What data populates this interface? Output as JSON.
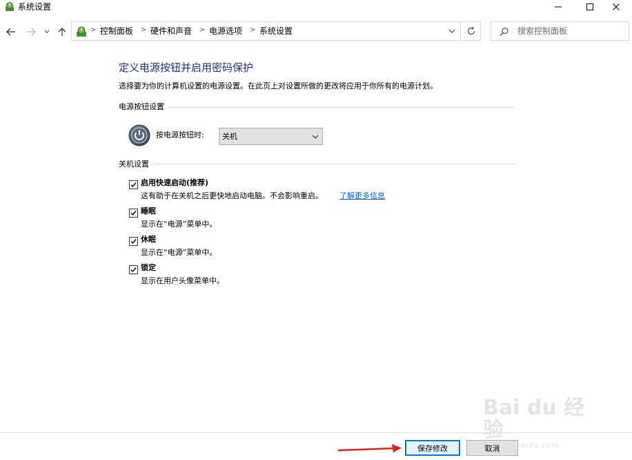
{
  "window": {
    "title": "系统设置",
    "icon": "power-options-icon"
  },
  "nav": {
    "back": "back-arrow-icon",
    "forward": "forward-arrow-icon",
    "recent": "chevron-down-icon",
    "up": "up-arrow-icon"
  },
  "breadcrumb": [
    "控制面板",
    "硬件和声音",
    "电源选项",
    "系统设置"
  ],
  "search": {
    "placeholder": "搜索控制面板"
  },
  "page": {
    "title": "定义电源按钮并启用密码保护",
    "description": "选择要为你的计算机设置的电源设置。在此页上对设置所做的更改将应用于你所有的电源计划。"
  },
  "power_button_section": {
    "heading": "电源按钮设置",
    "label": "按电源按钮时:",
    "selected": "关机"
  },
  "shutdown_section": {
    "heading": "关机设置",
    "items": [
      {
        "label": "启用快速启动(推荐)",
        "desc": "这有助于在关机之后更快地启动电脑。不会影响重启。",
        "link": "了解更多信息",
        "checked": true
      },
      {
        "label": "睡眠",
        "desc": "显示在“电源”菜单中。",
        "checked": true
      },
      {
        "label": "休眠",
        "desc": "显示在“电源”菜单中。",
        "checked": true
      },
      {
        "label": "锁定",
        "desc": "显示在用户头像菜单中。",
        "checked": true
      }
    ]
  },
  "footer": {
    "save_label": "保存修改",
    "cancel_label": "取消"
  },
  "watermark": {
    "text": "Bai du 经验",
    "sub": "jingyan.baidu.com"
  },
  "colors": {
    "title_blue": "#1e3287",
    "link_blue": "#0066cc",
    "accent": "#0078d7",
    "annotation_red": "#e0201e"
  }
}
